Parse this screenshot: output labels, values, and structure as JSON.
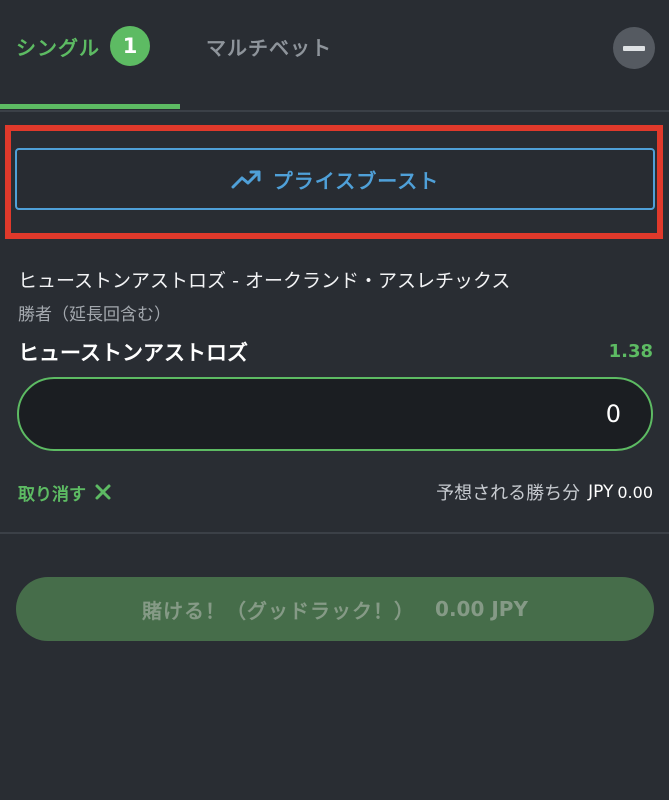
{
  "tabs": {
    "single_label": "シングル",
    "single_count": "1",
    "multi_label": "マルチベット",
    "active": "single"
  },
  "price_boost": {
    "label": "プライスブースト",
    "icon": "trending-up-icon"
  },
  "bet": {
    "match": "ヒューストンアストロズ - オークランド・アスレチックス",
    "market": "勝者（延長回含む）",
    "selection": "ヒューストンアストロズ",
    "odds": "1.38",
    "stake_value": "0",
    "cancel_label": "取り消す",
    "winnings_label": "予想される勝ち分",
    "winnings_currency": "JPY",
    "winnings_value": "0.00"
  },
  "place_bet": {
    "label": "賭ける！（グッドラック！）",
    "amount": "0.00 JPY"
  },
  "colors": {
    "accent_green": "#5dbb63",
    "boost_blue": "#4fa0d8",
    "highlight_red": "#e0392b",
    "background": "#292d33"
  }
}
